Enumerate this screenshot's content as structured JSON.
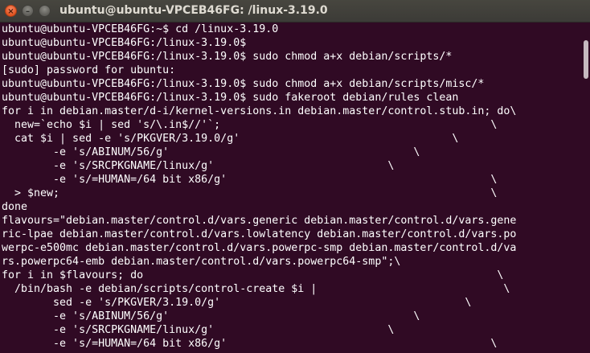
{
  "window": {
    "title": "ubuntu@ubuntu-VPCEB46FG: /linux-3.19.0",
    "close_glyph": "×",
    "minimize_glyph": "–",
    "maximize_glyph": ""
  },
  "terminal": {
    "lines": [
      "ubuntu@ubuntu-VPCEB46FG:~$ cd /linux-3.19.0",
      "ubuntu@ubuntu-VPCEB46FG:/linux-3.19.0$",
      "ubuntu@ubuntu-VPCEB46FG:/linux-3.19.0$ sudo chmod a+x debian/scripts/*",
      "[sudo] password for ubuntu:",
      "ubuntu@ubuntu-VPCEB46FG:/linux-3.19.0$ sudo chmod a+x debian/scripts/misc/*",
      "ubuntu@ubuntu-VPCEB46FG:/linux-3.19.0$ sudo fakeroot debian/rules clean",
      "for i in debian.master/d-i/kernel-versions.in debian.master/control.stub.in; do\\",
      "  new=`echo $i | sed 's/\\.in$//'`;                                          \\",
      "  cat $i | sed -e 's/PKGVER/3.19.0/g'                                 \\",
      "        -e 's/ABINUM/56/g'                                      \\",
      "        -e 's/SRCPKGNAME/linux/g'                           \\",
      "        -e 's/=HUMAN=/64 bit x86/g'                                         \\",
      "  > $new;                                                                   \\",
      "done",
      "flavours=\"debian.master/control.d/vars.generic debian.master/control.d/vars.gene",
      "ric-lpae debian.master/control.d/vars.lowlatency debian.master/control.d/vars.po",
      "werpc-e500mc debian.master/control.d/vars.powerpc-smp debian.master/control.d/va",
      "rs.powerpc64-emb debian.master/control.d/vars.powerpc64-smp\";\\",
      "for i in $flavours; do                                                       \\",
      "  /bin/bash -e debian/scripts/control-create $i |                             \\",
      "        sed -e 's/PKGVER/3.19.0/g'                                      \\",
      "        -e 's/ABINUM/56/g'                                      \\",
      "        -e 's/SRCPKGNAME/linux/g'                           \\",
      "        -e 's/=HUMAN=/64 bit x86/g'                                         \\"
    ]
  }
}
